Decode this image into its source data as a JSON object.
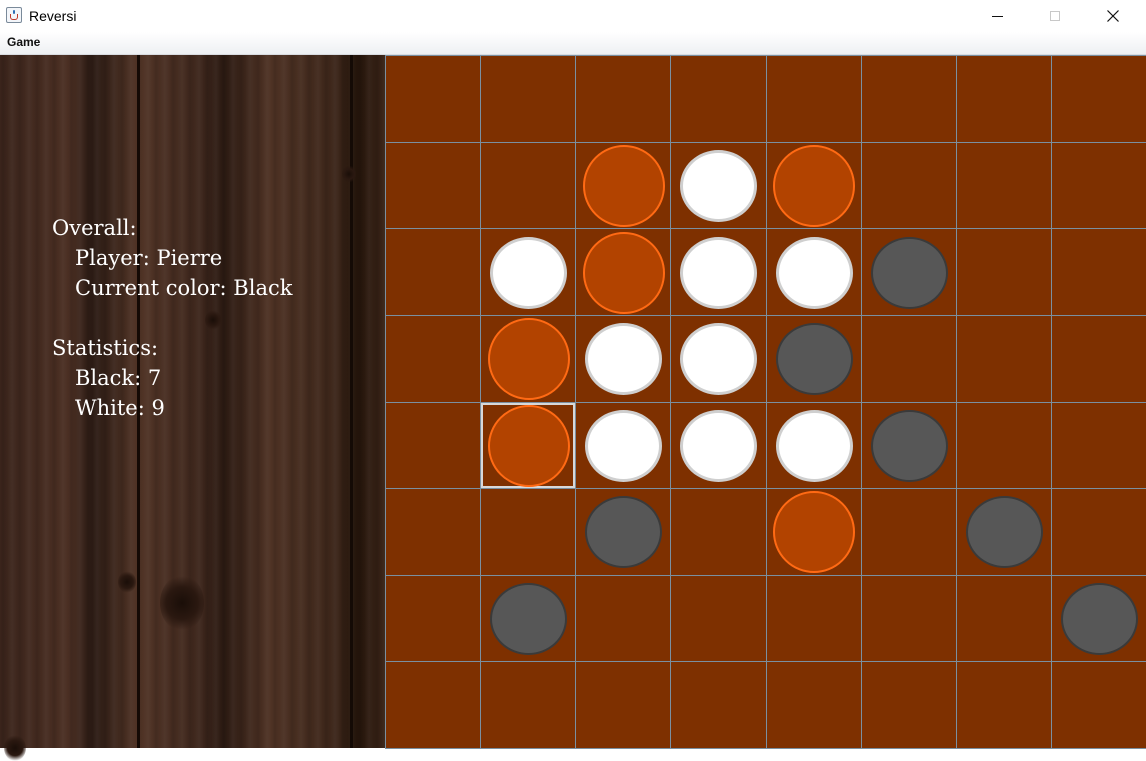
{
  "window": {
    "title": "Reversi",
    "icon": "java-cup-icon",
    "controls": [
      "minimize-icon",
      "maximize-icon",
      "close-icon"
    ]
  },
  "menu": {
    "items": [
      "Game"
    ]
  },
  "info": {
    "overall_label": "Overall:",
    "player_line": "Player: Pierre",
    "color_line": "Current color: Black",
    "statistics_label": "Statistics:",
    "black_line": "Black: 7",
    "white_line": "White: 9"
  },
  "colors": {
    "board": "#7e3000",
    "grid_line": "#7a8fa0",
    "white_piece": "#ffffff",
    "black_piece": "#575757",
    "hint_fill": "#b24300",
    "hint_ring": "#ff6a14"
  },
  "board": {
    "rows": 8,
    "cols": 8,
    "selected": {
      "row": 4,
      "col": 1
    },
    "cells": [
      [
        ".",
        ".",
        ".",
        ".",
        ".",
        ".",
        ".",
        "."
      ],
      [
        ".",
        ".",
        "H",
        "W",
        "H",
        ".",
        ".",
        "."
      ],
      [
        ".",
        "W",
        "H",
        "W",
        "W",
        "B",
        ".",
        "."
      ],
      [
        ".",
        "H",
        "W",
        "W",
        "B",
        ".",
        ".",
        "."
      ],
      [
        ".",
        "H",
        "W",
        "W",
        "W",
        "B",
        ".",
        "."
      ],
      [
        ".",
        ".",
        "B",
        ".",
        "H",
        ".",
        "B",
        "."
      ],
      [
        ".",
        "B",
        ".",
        ".",
        ".",
        ".",
        ".",
        "B"
      ],
      [
        ".",
        ".",
        ".",
        ".",
        ".",
        ".",
        ".",
        "."
      ]
    ]
  }
}
